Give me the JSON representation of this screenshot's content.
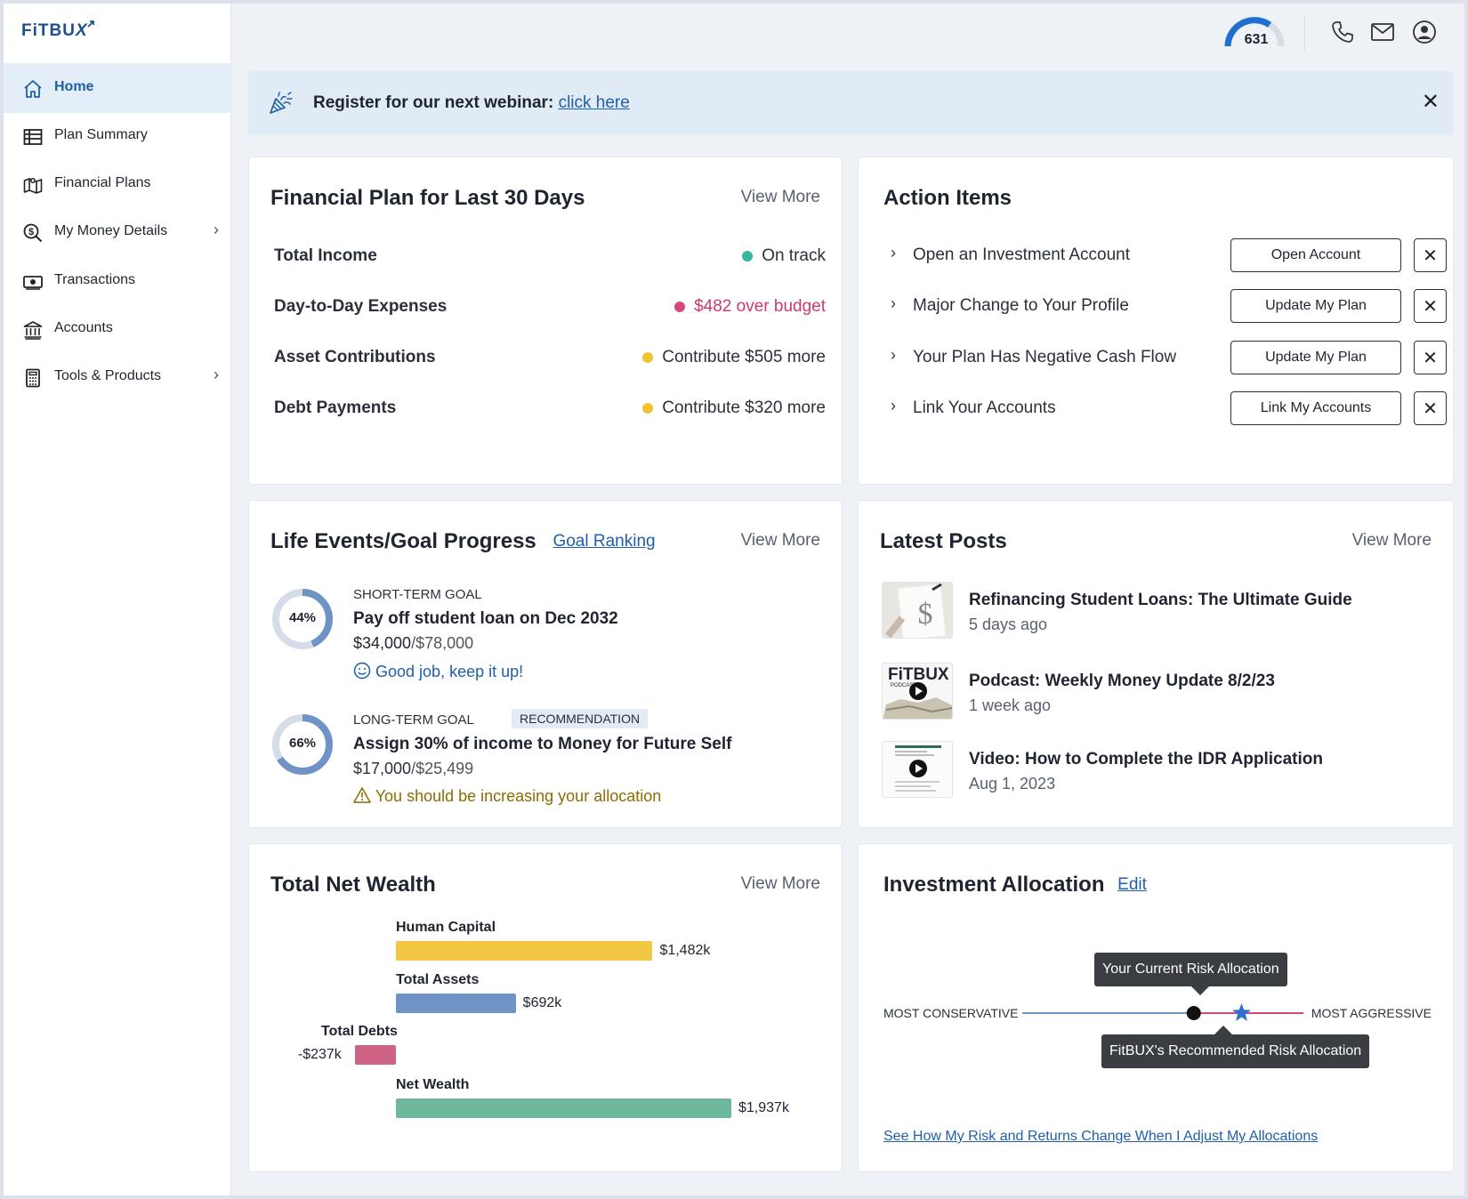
{
  "brand": {
    "name_left": "FiTBU",
    "name_x": "X"
  },
  "sidebar": {
    "items": [
      {
        "label": "Home",
        "icon": "home-icon",
        "active": true
      },
      {
        "label": "Plan Summary",
        "icon": "table-icon"
      },
      {
        "label": "Financial Plans",
        "icon": "map-icon"
      },
      {
        "label": "My Money Details",
        "icon": "dollar-search-icon",
        "has_submenu": true
      },
      {
        "label": "Transactions",
        "icon": "cash-icon"
      },
      {
        "label": "Accounts",
        "icon": "bank-icon"
      },
      {
        "label": "Tools & Products",
        "icon": "calculator-icon",
        "has_submenu": true
      }
    ]
  },
  "topbar": {
    "score": "631",
    "icons": [
      "phone-icon",
      "mail-icon",
      "user-icon"
    ]
  },
  "banner": {
    "text": "Register for our next webinar:",
    "link": "click here",
    "icon": "party-popper-icon"
  },
  "financial_plan": {
    "title": "Financial Plan for Last 30 Days",
    "view_more": "View More",
    "rows": [
      {
        "label": "Total Income",
        "status": "On track",
        "color": "#3bb5a0"
      },
      {
        "label": "Day-to-Day Expenses",
        "status": "$482 over budget",
        "color": "#d6477f"
      },
      {
        "label": "Asset Contributions",
        "status": "Contribute $505 more",
        "color": "#f0c330"
      },
      {
        "label": "Debt Payments",
        "status": "Contribute $320 more",
        "color": "#f0c330"
      }
    ]
  },
  "action_items": {
    "title": "Action Items",
    "items": [
      {
        "label": "Open an Investment Account",
        "button": "Open Account"
      },
      {
        "label": "Major Change to Your Profile",
        "button": "Update My Plan"
      },
      {
        "label": "Your Plan Has Negative Cash Flow",
        "button": "Update My Plan"
      },
      {
        "label": "Link Your Accounts",
        "button": "Link My Accounts"
      }
    ]
  },
  "goals": {
    "title": "Life Events/Goal Progress",
    "ranking_link": "Goal Ranking",
    "view_more": "View More",
    "items": [
      {
        "kind": "SHORT-TERM GOAL",
        "percent": 44,
        "percent_label": "44%",
        "name": "Pay off student loan on Dec 2032",
        "current": "$34,000",
        "target": "/$78,000",
        "message": "Good job, keep it up!",
        "message_icon": "smile-icon",
        "message_color": "#1f5fa8"
      },
      {
        "kind": "LONG-TERM GOAL",
        "badge": "RECOMMENDATION",
        "percent": 66,
        "percent_label": "66%",
        "name": "Assign 30% of income to Money for Future Self",
        "current": "$17,000",
        "target": "/$25,499",
        "message": "You should be increasing your allocation",
        "message_icon": "warning-icon",
        "message_color": "#8a6d00"
      }
    ]
  },
  "posts": {
    "title": "Latest Posts",
    "view_more": "View More",
    "items": [
      {
        "title": "Refinancing Student Loans: The Ultimate Guide",
        "time": "5 days ago",
        "thumb": "dollar-sketch-thumbnail"
      },
      {
        "title": "Podcast: Weekly Money Update 8/2/23",
        "time": "1 week ago",
        "thumb": "podcast-thumbnail",
        "thumb_text": "FiTBUX",
        "thumb_sub": "PODCAST"
      },
      {
        "title": "Video: How to Complete the IDR Application",
        "time": "Aug 1, 2023",
        "thumb": "video-thumbnail"
      }
    ]
  },
  "net_wealth": {
    "title": "Total Net Wealth",
    "view_more": "View More",
    "chart_data": {
      "type": "bar",
      "categories": [
        "Human Capital",
        "Total Assets",
        "Total Debts",
        "Net Wealth"
      ],
      "values": [
        1482,
        692,
        -237,
        1937
      ],
      "value_labels": [
        "$1,482k",
        "$692k",
        "-$237k",
        "$1,937k"
      ],
      "colors": [
        "#f2c744",
        "#6f93c4",
        "#cf6384",
        "#6db89a"
      ]
    }
  },
  "investment": {
    "title": "Investment Allocation",
    "edit": "Edit",
    "left_label": "MOST CONSERVATIVE",
    "right_label": "MOST AGGRESSIVE",
    "current_tooltip": "Your Current Risk Allocation",
    "recommended_tooltip": "FitBUX's Recommended Risk Allocation",
    "current_position": 0.61,
    "recommended_position": 0.78,
    "link": "See How My Risk and Returns Change When I Adjust My Allocations"
  }
}
